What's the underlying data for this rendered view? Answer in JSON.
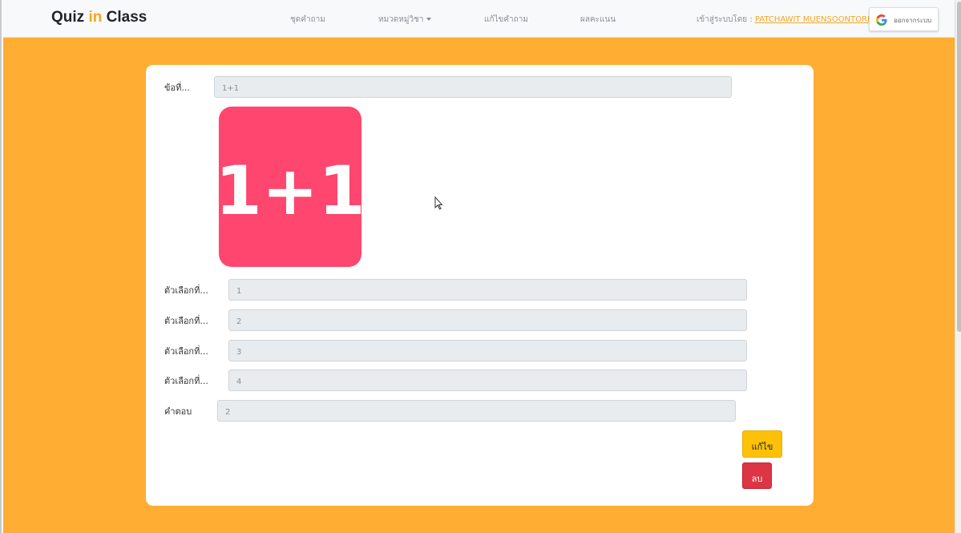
{
  "navbar": {
    "brand_part1": "Quiz",
    "brand_accent": "in",
    "brand_part2": "Class",
    "links": [
      "ชุดคำถาม",
      "หมวดหมู่วิชา",
      "แก้ไขคำถาม",
      "ผลคะแนน"
    ],
    "login_prefix": "เข้าสู่ระบบโดย :",
    "login_user": "PATCHAWIT MUENSOONTORN",
    "logout_label": "ออกจากระบบ",
    "logout_icon": "google-g-icon"
  },
  "form": {
    "question_label": "ข้อที่...",
    "question_value": "1+1",
    "image_text": "1+1",
    "image_color": "#ff466e",
    "choices": [
      {
        "label": "ตัวเลือกที่...",
        "value": "1"
      },
      {
        "label": "ตัวเลือกที่...",
        "value": "2"
      },
      {
        "label": "ตัวเลือกที่...",
        "value": "3"
      },
      {
        "label": "ตัวเลือกที่...",
        "value": "4"
      }
    ],
    "answer_label": "คำตอบ",
    "answer_value": "2"
  },
  "actions": {
    "edit_label": "แก้ไข",
    "delete_label": "ลบ"
  },
  "colors": {
    "background": "#ffad33",
    "brand_accent": "#f5a623",
    "edit_button": "#ffc107",
    "delete_button": "#dc3545"
  }
}
